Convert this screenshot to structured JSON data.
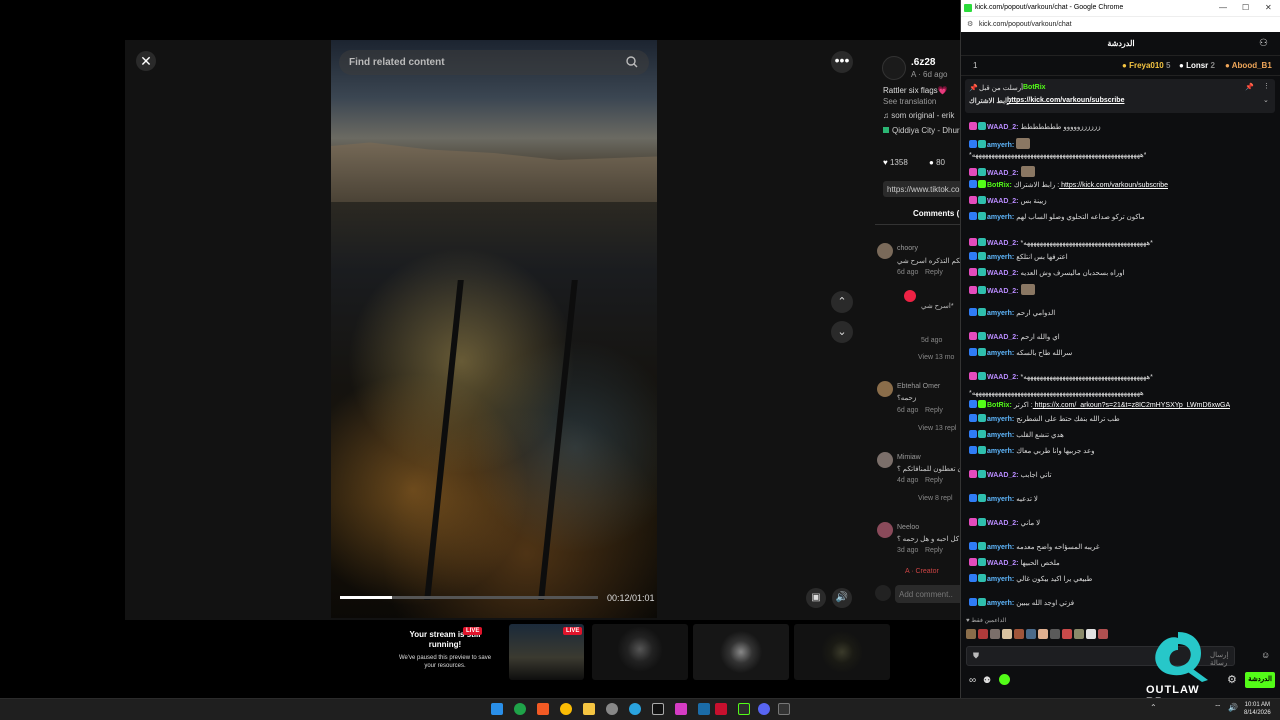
{
  "tiktok": {
    "search_placeholder": "Find related content",
    "video_time": "00:12/01:01",
    "progress_fraction": 0.2,
    "author": ".6z28",
    "author_sub": "A · 6d ago",
    "caption": "Rattler six flags💗",
    "see_translation": "See translation",
    "music": "som original - erik",
    "location": "Qiddiya City - Dhurm",
    "likes": "1358",
    "comments_count": "80",
    "link": "https://www.tiktok.co",
    "comments_tab": "Comments (",
    "comment_placeholder": "Add comment..",
    "comments": [
      {
        "name": "choory",
        "text": "بكم التذكره اسرح شي",
        "meta": "6d ago",
        "reply": "Reply"
      },
      {
        "name": "",
        "text": "اسرح شي*",
        "meta": "5d ago",
        "reply": ""
      },
      {
        "name": "Ebtehal Omer",
        "text": "زحمه؟",
        "meta": "6d ago",
        "reply": "Reply"
      },
      {
        "name": "Mimiaw",
        "text": "تعطلون تعطلون للمنافاتكم ؟",
        "meta": "4d ago",
        "reply": "Reply"
      },
      {
        "name": "Neeloo",
        "text": "كل احبه و هل زحمه ؟",
        "meta": "3d ago",
        "reply": "Reply"
      }
    ],
    "view_more": [
      "View 13 mo",
      "View 13 repl",
      "View 8 repl"
    ],
    "creator": "A · Creator"
  },
  "preview": {
    "stream_running": "Your stream is still running!",
    "paused_note": "We've paused this preview to save your resources.",
    "live": "LIVE"
  },
  "chrome": {
    "window_title": "kick.com/popout/varkoun/chat - Google Chrome",
    "url": "kick.com/popout/varkoun/chat"
  },
  "chat": {
    "header": "الدردشة",
    "count": "1",
    "gifters": [
      {
        "name": "Freya010",
        "n": "5",
        "color": "#f5c542"
      },
      {
        "name": "Lonsr",
        "n": "2",
        "color": "#ffffff"
      },
      {
        "name": "Abood_B1",
        "n": "",
        "color": "#f0a75a"
      }
    ],
    "pinned_by": "أرسلت من قبل",
    "pinned_user": "BotRix",
    "pinned_label": "رابط الاشتراك",
    "pinned_link": "https://kick.com/varkoun/subscribe",
    "messages": [
      {
        "user": "WAAD_2",
        "ucolor": "#b98cff",
        "text": "ززززززووووو ططططططط"
      },
      {
        "user": "amyerh",
        "ucolor": "#5fb8ff",
        "text": ""
      },
      {
        "user": "",
        "ucolor": "#ddd",
        "text": "*ههههههههههههههههههههههههههههههههههههههههههههههههههههه*"
      },
      {
        "user": "WAAD_2",
        "ucolor": "#b98cff",
        "text": ""
      },
      {
        "user": "BotRix",
        "ucolor": "#53fc18",
        "text": "رابط الاشتراك :",
        "link": "https://kick.com/varkoun/subscribe"
      },
      {
        "user": "WAAD_2",
        "ucolor": "#b98cff",
        "text": "زيينة بس"
      },
      {
        "user": "amyerh",
        "ucolor": "#5fb8ff",
        "text": "ماكون تركو صداعه التحلوي وصلو الساب لهم"
      },
      {
        "user": "WAAD_2",
        "ucolor": "#b98cff",
        "text": "*ههههههههههههههههههههههههههههههههههههههه*"
      },
      {
        "user": "amyerh",
        "ucolor": "#5fb8ff",
        "text": "اعترفها بس انتلكع"
      },
      {
        "user": "WAAD_2",
        "ucolor": "#b98cff",
        "text": "اوراه بسحدبان ماليسرف وش العديه"
      },
      {
        "user": "WAAD_2",
        "ucolor": "#b98cff",
        "text": ""
      },
      {
        "user": "amyerh",
        "ucolor": "#5fb8ff",
        "text": "الدوامي ارحم"
      },
      {
        "user": "WAAD_2",
        "ucolor": "#b98cff",
        "text": "اي والله ارحم"
      },
      {
        "user": "amyerh",
        "ucolor": "#5fb8ff",
        "text": "سرالله طاح بالسكه"
      },
      {
        "user": "WAAD_2",
        "ucolor": "#b98cff",
        "text": "*ههههههههههههههههههههههههههههههههههههههه*"
      },
      {
        "user": "",
        "ucolor": "#ddd",
        "text": "*ههههههههههههههههههههههههههههههههههههههههههههههههههههه"
      },
      {
        "user": "BotRix",
        "ucolor": "#53fc18",
        "text": "اكرتر :",
        "link": "https://x.com/_arkoun?s=21&t=z8IC2mHYSXYp_LWmD6xwGA"
      },
      {
        "user": "amyerh",
        "ucolor": "#5fb8ff",
        "text": "طب ترالله بنفك حتط على الشطرنج"
      },
      {
        "user": "amyerh",
        "ucolor": "#5fb8ff",
        "text": "هدي تنشع القلب"
      },
      {
        "user": "amyerh",
        "ucolor": "#5fb8ff",
        "text": "وعد جربيها وانا طربي معاك"
      },
      {
        "user": "WAAD_2",
        "ucolor": "#b98cff",
        "text": "تاتي اجابب"
      },
      {
        "user": "amyerh",
        "ucolor": "#5fb8ff",
        "text": "لا تدعيه"
      },
      {
        "user": "WAAD_2",
        "ucolor": "#b98cff",
        "text": "لا ماني"
      },
      {
        "user": "amyerh",
        "ucolor": "#5fb8ff",
        "text": "غريبه المسؤاحه واضح معدمه"
      },
      {
        "user": "WAAD_2",
        "ucolor": "#b98cff",
        "text": "ملخص الحبيها"
      },
      {
        "user": "amyerh",
        "ucolor": "#5fb8ff",
        "text": "طبيعي يرا اكيد بيكون غالي"
      },
      {
        "user": "amyerh",
        "ucolor": "#5fb8ff",
        "text": "فزتي اوجد الله بيبين"
      }
    ],
    "supporters_label": "الداعمين فقط",
    "input_placeholder": "إرسال رسالة",
    "send_label": "الدردشة"
  },
  "taskbar": {
    "time": "10:01 AM",
    "date": "8/14/2026"
  },
  "logo": {
    "text": "OUTLAW RP"
  }
}
